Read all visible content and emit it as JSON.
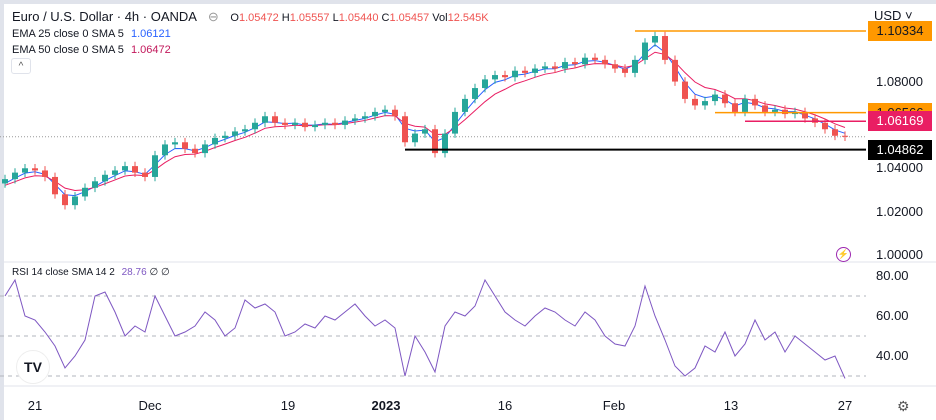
{
  "header": {
    "symbol": "Euro / U.S. Dollar · 4h · OANDA",
    "o_label": "O",
    "o": "1.05472",
    "h_label": "H",
    "h": "1.05557",
    "l_label": "L",
    "l": "1.05440",
    "c_label": "C",
    "c": "1.05457",
    "vol_label": "Vol",
    "vol": "12.545K",
    "ema25_label": "EMA 25 close 0 SMA 5",
    "ema25": "1.06121",
    "ema50_label": "EMA 50 close 0 SMA 5",
    "ema50": "1.06472",
    "collapse": "^"
  },
  "axis": {
    "currency": "USD ˅",
    "price_ticks": [
      "1.08000",
      "1.04000",
      "1.02000",
      "1.00000"
    ],
    "rsi_ticks": [
      "80.00",
      "60.00",
      "40.00"
    ],
    "time_ticks": [
      "21",
      "Dec",
      "19",
      "2023",
      "16",
      "Feb",
      "13",
      "27"
    ]
  },
  "rsi_legend": {
    "label": "RSI 14 close SMA 14 2",
    "value": "28.76",
    "n1": "∅",
    "n2": "∅"
  },
  "logo": "TV",
  "colors": {
    "up": "#26a69a",
    "down": "#ef5350",
    "ema25": "#2962ff",
    "ema50": "#e91e63",
    "orange": "#ff9800",
    "pink": "#e91e63",
    "rsi": "#7e57c2"
  },
  "chart_data": {
    "type": "candlestick",
    "title": "Euro / U.S. Dollar · 4h · OANDA",
    "x_ticks": [
      "21",
      "Dec",
      "19",
      "2023",
      "16",
      "Feb",
      "13",
      "27"
    ],
    "ylim": [
      1.0,
      1.10334
    ],
    "closes": [
      1.035,
      1.038,
      1.04,
      1.039,
      1.036,
      1.028,
      1.023,
      1.027,
      1.031,
      1.034,
      1.037,
      1.039,
      1.041,
      1.038,
      1.036,
      1.046,
      1.051,
      1.052,
      1.049,
      1.047,
      1.051,
      1.054,
      1.055,
      1.057,
      1.058,
      1.061,
      1.064,
      1.061,
      1.06,
      1.061,
      1.059,
      1.06,
      1.061,
      1.06,
      1.062,
      1.063,
      1.064,
      1.066,
      1.067,
      1.064,
      1.052,
      1.056,
      1.058,
      1.047,
      1.056,
      1.066,
      1.072,
      1.077,
      1.081,
      1.083,
      1.082,
      1.085,
      1.084,
      1.086,
      1.087,
      1.086,
      1.089,
      1.088,
      1.091,
      1.09,
      1.088,
      1.086,
      1.084,
      1.09,
      1.098,
      1.101,
      1.09,
      1.08,
      1.072,
      1.069,
      1.071,
      1.074,
      1.07,
      1.066,
      1.072,
      1.069,
      1.066,
      1.067,
      1.065,
      1.066,
      1.063,
      1.061,
      1.058,
      1.055,
      1.05457
    ],
    "rsi": [
      70,
      78,
      60,
      58,
      52,
      45,
      34,
      40,
      48,
      70,
      72,
      62,
      50,
      55,
      52,
      70,
      60,
      50,
      52,
      55,
      62,
      58,
      50,
      54,
      68,
      64,
      66,
      62,
      50,
      52,
      56,
      54,
      60,
      58,
      62,
      66,
      60,
      55,
      58,
      54,
      30,
      50,
      42,
      32,
      55,
      62,
      60,
      65,
      78,
      70,
      62,
      58,
      55,
      60,
      64,
      62,
      58,
      55,
      62,
      58,
      50,
      46,
      45,
      55,
      75,
      60,
      48,
      35,
      30,
      34,
      45,
      42,
      52,
      40,
      46,
      58,
      48,
      52,
      42,
      50,
      46,
      42,
      38,
      40,
      28.76
    ],
    "rsi_levels": [
      70,
      50,
      30
    ],
    "levels": [
      {
        "price": "1.10334",
        "value": 1.10334,
        "color": "#ff9800",
        "from_bar": 63
      },
      {
        "price": "1.06566",
        "value": 1.06566,
        "color": "#ff9800",
        "from_bar": 71
      },
      {
        "price": "1.06169",
        "value": 1.06169,
        "color": "#e91e63",
        "from_bar": 74
      },
      {
        "price": "1.04862",
        "value": 1.04862,
        "color": "#000000",
        "from_bar": 40
      }
    ],
    "current_price": 1.05457
  }
}
